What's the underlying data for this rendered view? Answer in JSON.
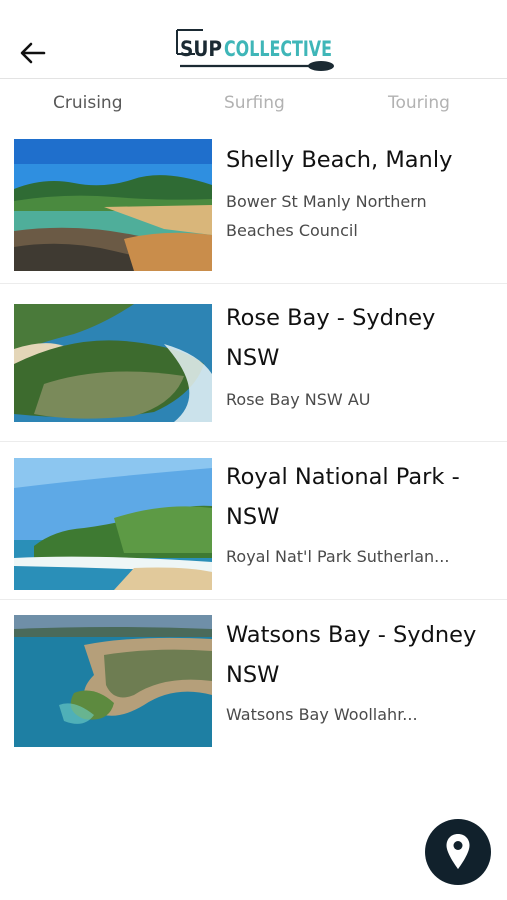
{
  "header": {
    "logo_sup": "SUP",
    "logo_collective": "COLLECTIVE",
    "back_icon": "arrow-left-icon"
  },
  "tabs": [
    {
      "label": "Cruising",
      "active": true
    },
    {
      "label": "Surfing",
      "active": false
    },
    {
      "label": "Touring",
      "active": false
    }
  ],
  "locations": [
    {
      "name": "Shelly Beach, Manly",
      "address": "Bower St Manly Northern Beaches Council"
    },
    {
      "name": "Rose Bay - Sydney NSW",
      "address": "Rose Bay NSW AU"
    },
    {
      "name": "Royal National Park - NSW",
      "address": "Royal Nat'l Park Sutherlan..."
    },
    {
      "name": "Watsons Bay - Sydney NSW",
      "address": "Watsons Bay Woollahr..."
    }
  ],
  "map_button": {
    "icon": "map-pin-icon"
  },
  "colors": {
    "fab": "#11212c",
    "logo_teal": "#3fb6b8",
    "logo_dark": "#1b2a33"
  }
}
